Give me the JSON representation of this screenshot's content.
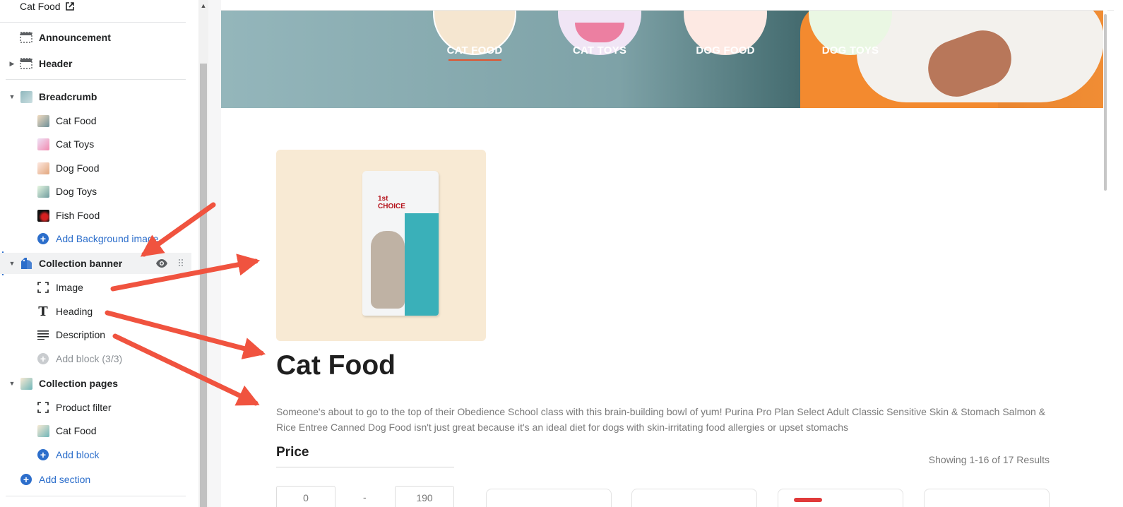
{
  "sidebar": {
    "top_link": "Cat Food",
    "items": [
      {
        "label": "Announcement"
      },
      {
        "label": "Header"
      },
      {
        "label": "Breadcrumb"
      },
      {
        "label": "Cat Food"
      },
      {
        "label": "Cat Toys"
      },
      {
        "label": "Dog Food"
      },
      {
        "label": "Dog Toys"
      },
      {
        "label": "Fish Food"
      },
      {
        "label": "Add Background image"
      },
      {
        "label": "Collection banner"
      },
      {
        "label": "Image"
      },
      {
        "label": "Heading"
      },
      {
        "label": "Description"
      },
      {
        "label": "Add block (3/3)"
      },
      {
        "label": "Collection pages"
      },
      {
        "label": "Product filter"
      },
      {
        "label": "Cat Food"
      },
      {
        "label": "Add block"
      },
      {
        "label": "Add section"
      }
    ]
  },
  "preview": {
    "categories": [
      "CAT FOOD",
      "CAT TOYS",
      "DOG FOOD",
      "DOG TOYS"
    ],
    "heading": "Cat Food",
    "description": "Someone's about to go to the top of their Obedience School class with this brain-building bowl of yum! Purina Pro Plan Select Adult Classic Sensitive Skin & Stomach Salmon & Rice Entree Canned Dog Food isn't just great because it's an ideal diet for dogs with skin-irritating food allergies or upset stomachs",
    "price_title": "Price",
    "price_min": "0",
    "price_separator": "-",
    "price_max": "190",
    "results_text": "Showing 1-16 of 17 Results",
    "bag_brand": "1st CHOICE"
  },
  "colors": {
    "accent": "#2c6ecb",
    "annotation_arrow": "#f0533f",
    "underline": "#e0552f"
  }
}
